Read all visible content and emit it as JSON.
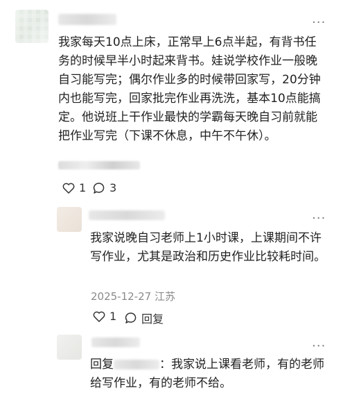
{
  "comment": {
    "text": "我家每天10点上床，正常早上6点半起，有背书任务的时候早半小时起来背书。娃说学校作业一般晚自习能写完；偶尔作业多的时候带回家写，20分钟内也能写完，回家批完作业再洗洗，基本10点能搞定。他说班上干作业最快的学霸每天晚自习前就能把作业写完（下课不休息，中午不午休）。",
    "likes": "1",
    "replies": "3",
    "more_icon": "more-dots-icon"
  },
  "reply1": {
    "text": "我家说晚自习老师上1小时课，上课期间不许写作业，尤其是政治和历史作业比较耗时间。",
    "date": "2025-12-27",
    "location": "江苏",
    "likes": "1",
    "reply_label": "回复"
  },
  "reply2": {
    "prefix": "回复",
    "text": "：我家说上课看老师，有的老师给写作业，有的老师不给。"
  },
  "colors": {
    "text": "#1f1f1f",
    "meta": "#8a8a8a",
    "background": "#ffffff"
  }
}
